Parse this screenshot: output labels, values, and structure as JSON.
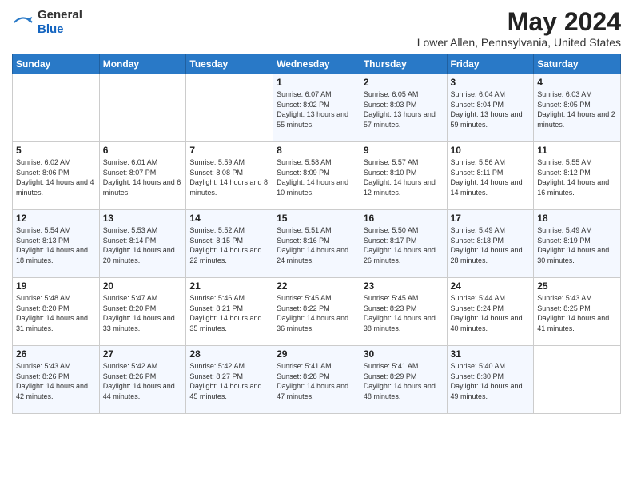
{
  "header": {
    "logo_general": "General",
    "logo_blue": "Blue",
    "title": "May 2024",
    "location": "Lower Allen, Pennsylvania, United States"
  },
  "weekdays": [
    "Sunday",
    "Monday",
    "Tuesday",
    "Wednesday",
    "Thursday",
    "Friday",
    "Saturday"
  ],
  "weeks": [
    [
      {
        "day": "",
        "sunrise": "",
        "sunset": "",
        "daylight": ""
      },
      {
        "day": "",
        "sunrise": "",
        "sunset": "",
        "daylight": ""
      },
      {
        "day": "",
        "sunrise": "",
        "sunset": "",
        "daylight": ""
      },
      {
        "day": "1",
        "sunrise": "Sunrise: 6:07 AM",
        "sunset": "Sunset: 8:02 PM",
        "daylight": "Daylight: 13 hours and 55 minutes."
      },
      {
        "day": "2",
        "sunrise": "Sunrise: 6:05 AM",
        "sunset": "Sunset: 8:03 PM",
        "daylight": "Daylight: 13 hours and 57 minutes."
      },
      {
        "day": "3",
        "sunrise": "Sunrise: 6:04 AM",
        "sunset": "Sunset: 8:04 PM",
        "daylight": "Daylight: 13 hours and 59 minutes."
      },
      {
        "day": "4",
        "sunrise": "Sunrise: 6:03 AM",
        "sunset": "Sunset: 8:05 PM",
        "daylight": "Daylight: 14 hours and 2 minutes."
      }
    ],
    [
      {
        "day": "5",
        "sunrise": "Sunrise: 6:02 AM",
        "sunset": "Sunset: 8:06 PM",
        "daylight": "Daylight: 14 hours and 4 minutes."
      },
      {
        "day": "6",
        "sunrise": "Sunrise: 6:01 AM",
        "sunset": "Sunset: 8:07 PM",
        "daylight": "Daylight: 14 hours and 6 minutes."
      },
      {
        "day": "7",
        "sunrise": "Sunrise: 5:59 AM",
        "sunset": "Sunset: 8:08 PM",
        "daylight": "Daylight: 14 hours and 8 minutes."
      },
      {
        "day": "8",
        "sunrise": "Sunrise: 5:58 AM",
        "sunset": "Sunset: 8:09 PM",
        "daylight": "Daylight: 14 hours and 10 minutes."
      },
      {
        "day": "9",
        "sunrise": "Sunrise: 5:57 AM",
        "sunset": "Sunset: 8:10 PM",
        "daylight": "Daylight: 14 hours and 12 minutes."
      },
      {
        "day": "10",
        "sunrise": "Sunrise: 5:56 AM",
        "sunset": "Sunset: 8:11 PM",
        "daylight": "Daylight: 14 hours and 14 minutes."
      },
      {
        "day": "11",
        "sunrise": "Sunrise: 5:55 AM",
        "sunset": "Sunset: 8:12 PM",
        "daylight": "Daylight: 14 hours and 16 minutes."
      }
    ],
    [
      {
        "day": "12",
        "sunrise": "Sunrise: 5:54 AM",
        "sunset": "Sunset: 8:13 PM",
        "daylight": "Daylight: 14 hours and 18 minutes."
      },
      {
        "day": "13",
        "sunrise": "Sunrise: 5:53 AM",
        "sunset": "Sunset: 8:14 PM",
        "daylight": "Daylight: 14 hours and 20 minutes."
      },
      {
        "day": "14",
        "sunrise": "Sunrise: 5:52 AM",
        "sunset": "Sunset: 8:15 PM",
        "daylight": "Daylight: 14 hours and 22 minutes."
      },
      {
        "day": "15",
        "sunrise": "Sunrise: 5:51 AM",
        "sunset": "Sunset: 8:16 PM",
        "daylight": "Daylight: 14 hours and 24 minutes."
      },
      {
        "day": "16",
        "sunrise": "Sunrise: 5:50 AM",
        "sunset": "Sunset: 8:17 PM",
        "daylight": "Daylight: 14 hours and 26 minutes."
      },
      {
        "day": "17",
        "sunrise": "Sunrise: 5:49 AM",
        "sunset": "Sunset: 8:18 PM",
        "daylight": "Daylight: 14 hours and 28 minutes."
      },
      {
        "day": "18",
        "sunrise": "Sunrise: 5:49 AM",
        "sunset": "Sunset: 8:19 PM",
        "daylight": "Daylight: 14 hours and 30 minutes."
      }
    ],
    [
      {
        "day": "19",
        "sunrise": "Sunrise: 5:48 AM",
        "sunset": "Sunset: 8:20 PM",
        "daylight": "Daylight: 14 hours and 31 minutes."
      },
      {
        "day": "20",
        "sunrise": "Sunrise: 5:47 AM",
        "sunset": "Sunset: 8:20 PM",
        "daylight": "Daylight: 14 hours and 33 minutes."
      },
      {
        "day": "21",
        "sunrise": "Sunrise: 5:46 AM",
        "sunset": "Sunset: 8:21 PM",
        "daylight": "Daylight: 14 hours and 35 minutes."
      },
      {
        "day": "22",
        "sunrise": "Sunrise: 5:45 AM",
        "sunset": "Sunset: 8:22 PM",
        "daylight": "Daylight: 14 hours and 36 minutes."
      },
      {
        "day": "23",
        "sunrise": "Sunrise: 5:45 AM",
        "sunset": "Sunset: 8:23 PM",
        "daylight": "Daylight: 14 hours and 38 minutes."
      },
      {
        "day": "24",
        "sunrise": "Sunrise: 5:44 AM",
        "sunset": "Sunset: 8:24 PM",
        "daylight": "Daylight: 14 hours and 40 minutes."
      },
      {
        "day": "25",
        "sunrise": "Sunrise: 5:43 AM",
        "sunset": "Sunset: 8:25 PM",
        "daylight": "Daylight: 14 hours and 41 minutes."
      }
    ],
    [
      {
        "day": "26",
        "sunrise": "Sunrise: 5:43 AM",
        "sunset": "Sunset: 8:26 PM",
        "daylight": "Daylight: 14 hours and 42 minutes."
      },
      {
        "day": "27",
        "sunrise": "Sunrise: 5:42 AM",
        "sunset": "Sunset: 8:26 PM",
        "daylight": "Daylight: 14 hours and 44 minutes."
      },
      {
        "day": "28",
        "sunrise": "Sunrise: 5:42 AM",
        "sunset": "Sunset: 8:27 PM",
        "daylight": "Daylight: 14 hours and 45 minutes."
      },
      {
        "day": "29",
        "sunrise": "Sunrise: 5:41 AM",
        "sunset": "Sunset: 8:28 PM",
        "daylight": "Daylight: 14 hours and 47 minutes."
      },
      {
        "day": "30",
        "sunrise": "Sunrise: 5:41 AM",
        "sunset": "Sunset: 8:29 PM",
        "daylight": "Daylight: 14 hours and 48 minutes."
      },
      {
        "day": "31",
        "sunrise": "Sunrise: 5:40 AM",
        "sunset": "Sunset: 8:30 PM",
        "daylight": "Daylight: 14 hours and 49 minutes."
      },
      {
        "day": "",
        "sunrise": "",
        "sunset": "",
        "daylight": ""
      }
    ]
  ]
}
